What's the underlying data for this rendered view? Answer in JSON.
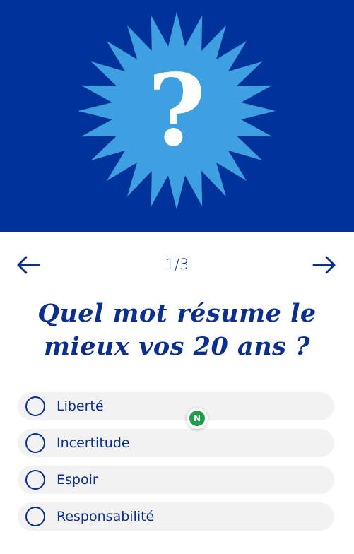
{
  "colors": {
    "hero_background": "#003399",
    "starburst": "#3ea0e0",
    "question_mark": "#ffffff",
    "accent_text": "#0b2f91",
    "option_background": "#f2f2f2",
    "badge_green": "#1f9d4a"
  },
  "hero": {
    "icon": "starburst-question-icon",
    "symbol": "?"
  },
  "nav": {
    "prev_icon": "arrow-left-icon",
    "next_icon": "arrow-right-icon",
    "progress": "1/3"
  },
  "question": {
    "line1": "Quel mot résume le",
    "line2": "mieux vos 20 ans ?"
  },
  "options": [
    {
      "label": "Liberté"
    },
    {
      "label": "Incertitude"
    },
    {
      "label": "Espoir"
    },
    {
      "label": "Responsabilité"
    }
  ],
  "badge": {
    "letter": "N",
    "icon": "n-badge-icon"
  }
}
